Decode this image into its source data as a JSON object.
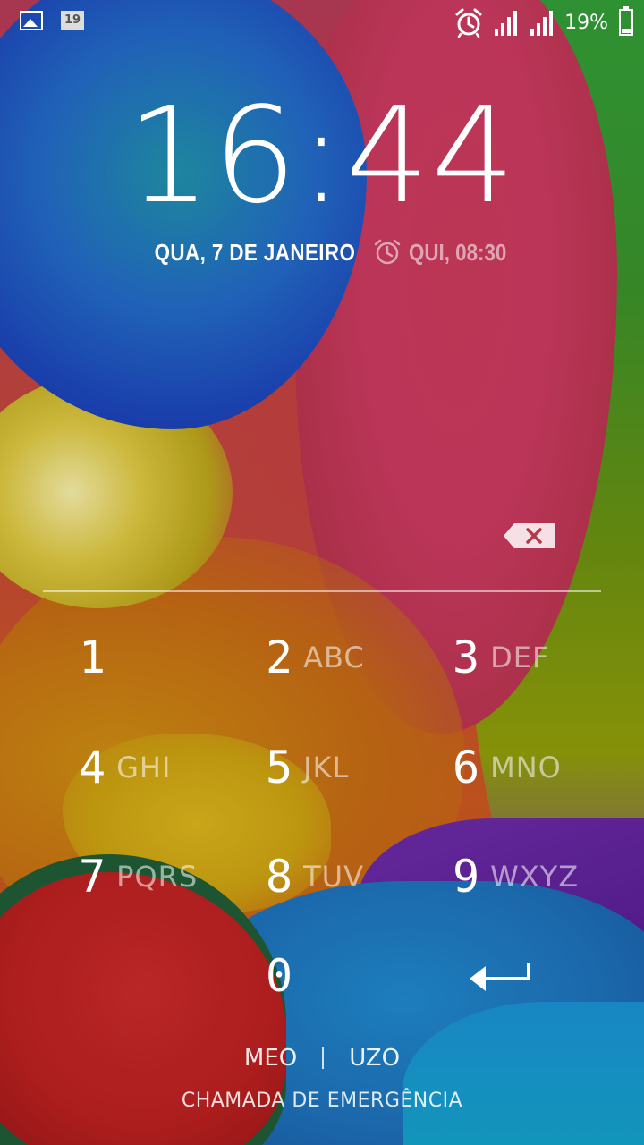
{
  "status_bar": {
    "notification_icons": [
      "gallery-icon",
      "calendar-icon"
    ],
    "calendar_day": "19",
    "right_icons": [
      "alarm-icon",
      "signal-icon",
      "signal-icon"
    ],
    "battery_percent": "19%"
  },
  "clock": {
    "time": "16:44",
    "date": "QUA, 7 DE JANEIRO",
    "next_alarm": "QUI, 08:30"
  },
  "keypad": {
    "keys": [
      {
        "digit": "1",
        "letters": ""
      },
      {
        "digit": "2",
        "letters": "ABC"
      },
      {
        "digit": "3",
        "letters": "DEF"
      },
      {
        "digit": "4",
        "letters": "GHI"
      },
      {
        "digit": "5",
        "letters": "JKL"
      },
      {
        "digit": "6",
        "letters": "MNO"
      },
      {
        "digit": "7",
        "letters": "PQRS"
      },
      {
        "digit": "8",
        "letters": "TUV"
      },
      {
        "digit": "9",
        "letters": "WXYZ"
      },
      {
        "digit": "0",
        "letters": ""
      }
    ],
    "delete_icon": "backspace-icon",
    "enter_icon": "enter-arrow-icon"
  },
  "carriers": [
    "MEO",
    "UZO"
  ],
  "emergency_call": "CHAMADA DE EMERGÊNCIA"
}
